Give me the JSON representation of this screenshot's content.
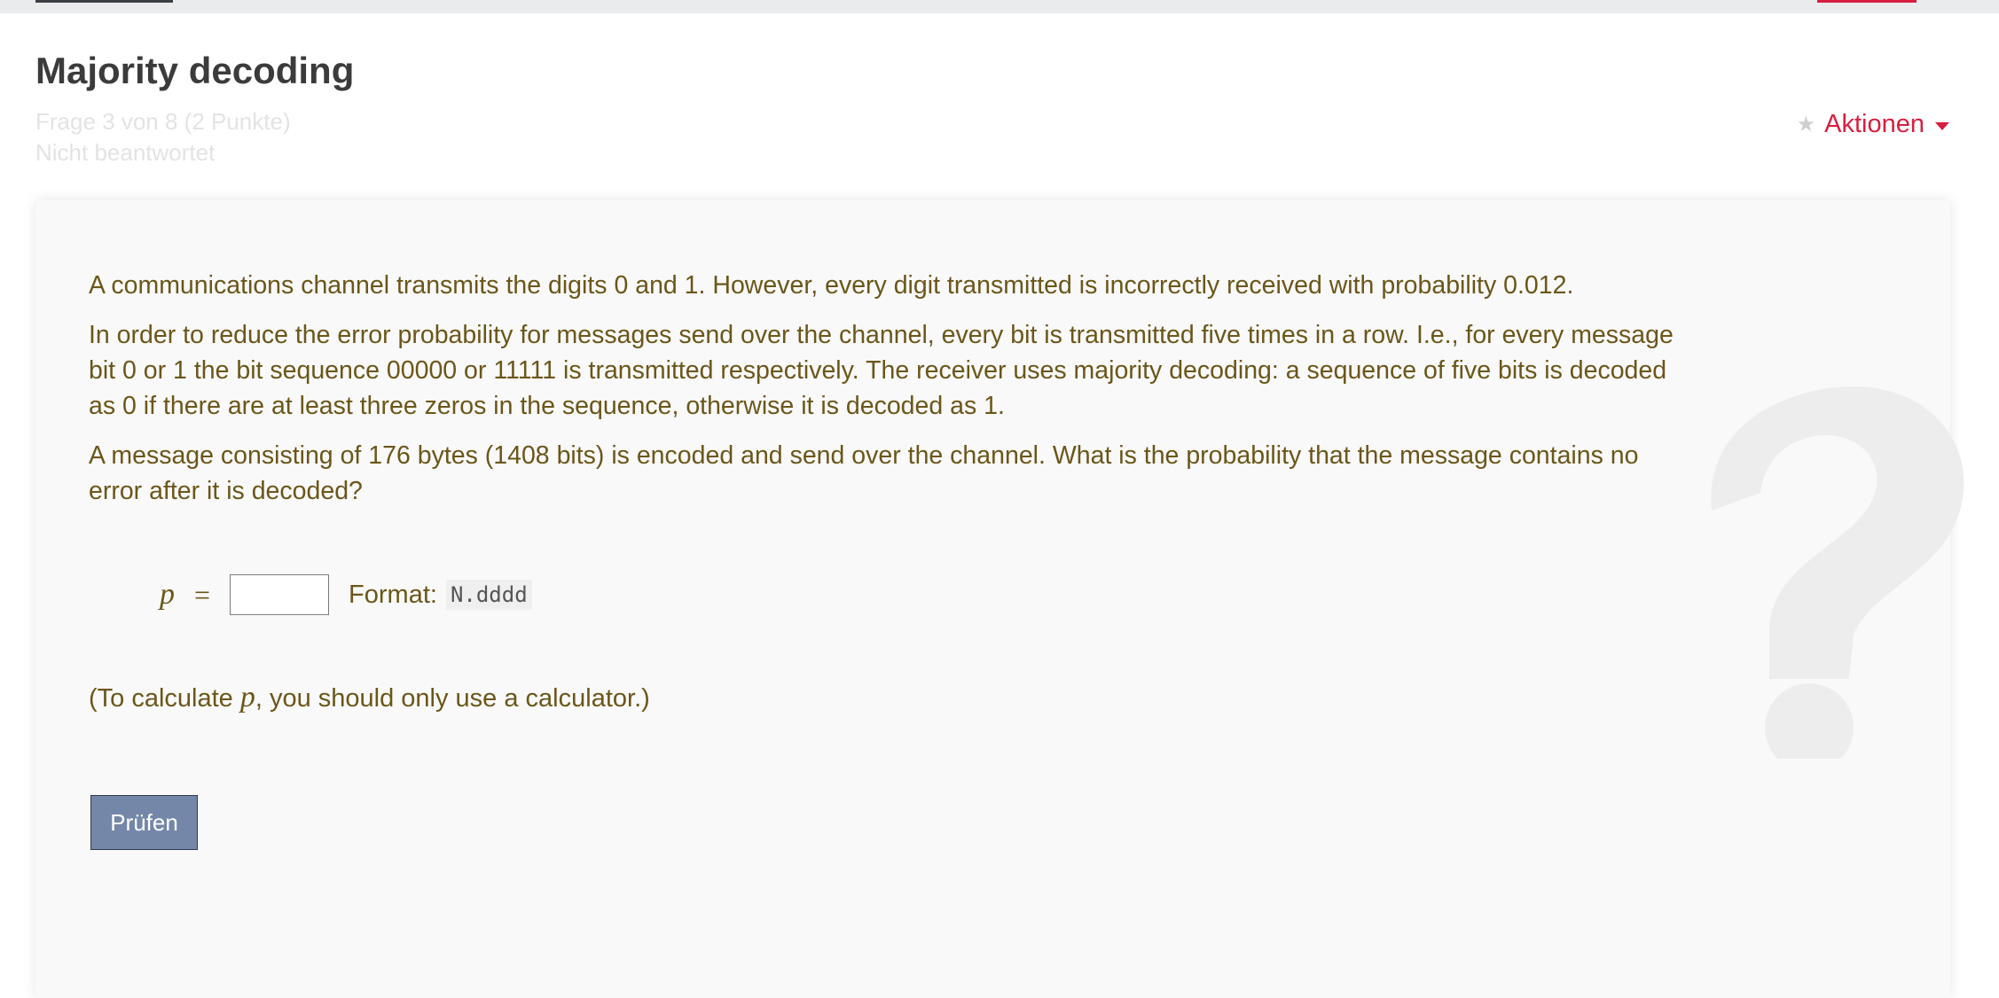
{
  "page": {
    "title": "Majority decoding",
    "question_info": "Frage 3 von 8 (2 Punkte)",
    "status": "Nicht beantwortet",
    "actions_label": "Aktionen"
  },
  "question": {
    "paragraphs": [
      "A communications channel transmits the digits 0 and 1. However, every digit transmitted is incorrectly received with probability 0.012.",
      "In order to reduce the error probability for messages send over the channel, every bit is transmitted five times in a row. I.e., for every message bit 0 or 1 the bit sequence 00000 or 11111 is transmitted respectively. The receiver uses majority decoding: a sequence of five bits is decoded as 0 if there are at least three zeros in the sequence, otherwise it is decoded as 1.",
      "A message consisting of 176 bytes (1408 bits) is encoded and send over the channel. What is the probability that the message contains no error after it is decoded?"
    ],
    "answer": {
      "variable": "p",
      "equals": "=",
      "value": "",
      "format_label": "Format:",
      "format_code": "N.dddd"
    },
    "hint_before": "(To calculate ",
    "hint_variable": "p",
    "hint_after": ", you should only use a calculator.)",
    "check_button_label": "Prüfen"
  },
  "icons": {
    "star": "star-icon",
    "caret": "caret-down-icon",
    "question_mark": "question-mark-icon"
  },
  "colors": {
    "accent": "#d61f3f",
    "question_text": "#6b5619",
    "button": "#7487a8"
  }
}
